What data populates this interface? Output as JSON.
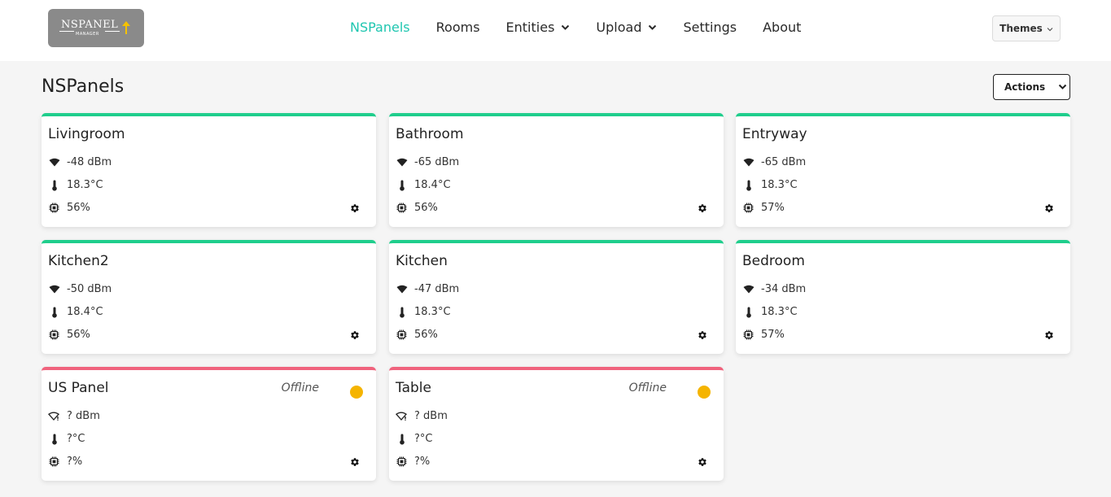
{
  "logo": {
    "text": "NSPANEL",
    "sub": "MANAGER"
  },
  "nav": {
    "links": [
      {
        "label": "NSPanels",
        "active": true
      },
      {
        "label": "Rooms"
      },
      {
        "label": "Entities",
        "dropdown": true
      },
      {
        "label": "Upload",
        "dropdown": true
      },
      {
        "label": "Settings"
      },
      {
        "label": "About"
      }
    ],
    "themes_label": "Themes"
  },
  "page": {
    "title": "NSPanels",
    "actions_label": "Actions"
  },
  "colors": {
    "accent": "#1fc6b0",
    "online_bar": "#1fce8c",
    "offline_bar": "#f0637d",
    "offline_dot": "#f5b400"
  },
  "panels": [
    {
      "name": "Livingroom",
      "signal": "-48 dBm",
      "temperature": "18.3°C",
      "cpu": "56%",
      "online": true
    },
    {
      "name": "Bathroom",
      "signal": "-65 dBm",
      "temperature": "18.4°C",
      "cpu": "56%",
      "online": true
    },
    {
      "name": "Entryway",
      "signal": "-65 dBm",
      "temperature": "18.3°C",
      "cpu": "57%",
      "online": true
    },
    {
      "name": "Kitchen2",
      "signal": "-50 dBm",
      "temperature": "18.4°C",
      "cpu": "56%",
      "online": true
    },
    {
      "name": "Kitchen",
      "signal": "-47 dBm",
      "temperature": "18.3°C",
      "cpu": "56%",
      "online": true
    },
    {
      "name": "Bedroom",
      "signal": "-34 dBm",
      "temperature": "18.3°C",
      "cpu": "57%",
      "online": true
    },
    {
      "name": "US Panel",
      "signal": "? dBm",
      "temperature": "?°C",
      "cpu": "?%",
      "online": false,
      "status": "Offline"
    },
    {
      "name": "Table",
      "signal": "? dBm",
      "temperature": "?°C",
      "cpu": "?%",
      "online": false,
      "status": "Offline"
    }
  ]
}
